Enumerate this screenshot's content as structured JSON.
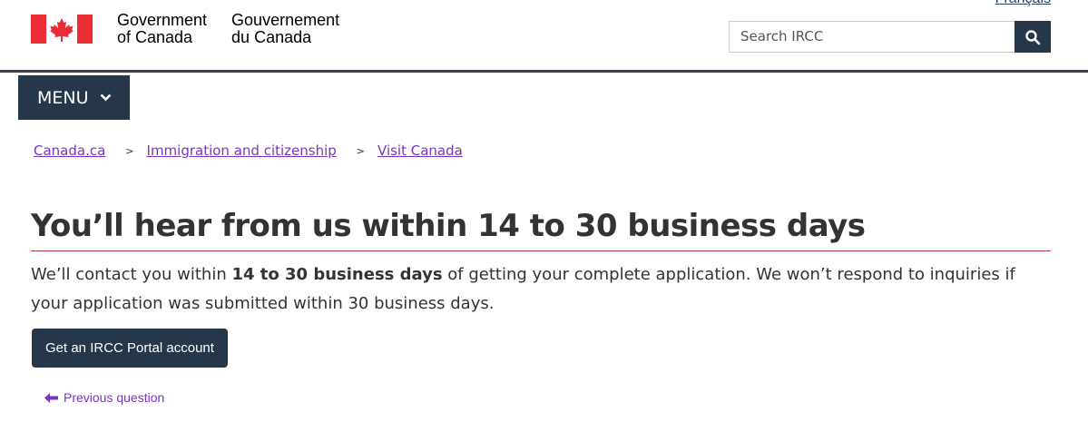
{
  "header": {
    "language_link": "Français",
    "signature_en_line1": "Government",
    "signature_en_line2": "of Canada",
    "signature_fr_line1": "Gouvernement",
    "signature_fr_line2": "du Canada",
    "search_placeholder": "Search IRCC",
    "search_icon": "search-icon",
    "flag_color": "#eb2d37"
  },
  "menu": {
    "label": "MENU",
    "icon": "chevron-down-icon"
  },
  "breadcrumb": {
    "items": [
      "Canada.ca",
      "Immigration and citizenship",
      "Visit Canada"
    ],
    "separator": ">"
  },
  "main": {
    "title": "You’ll hear from us within 14 to 30 business days",
    "paragraph_before": "We’ll contact you within ",
    "paragraph_bold": "14 to 30 business days",
    "paragraph_after": " of getting your complete application. We won’t respond to inquiries if your application was submitted within 30 business days.",
    "button_label": "Get an IRCC Portal account",
    "prev_link": "Previous question",
    "prev_icon": "arrow-left-icon"
  },
  "colors": {
    "navy": "#26374a",
    "link": "#7834bc",
    "title_rule": "#af3c43"
  }
}
